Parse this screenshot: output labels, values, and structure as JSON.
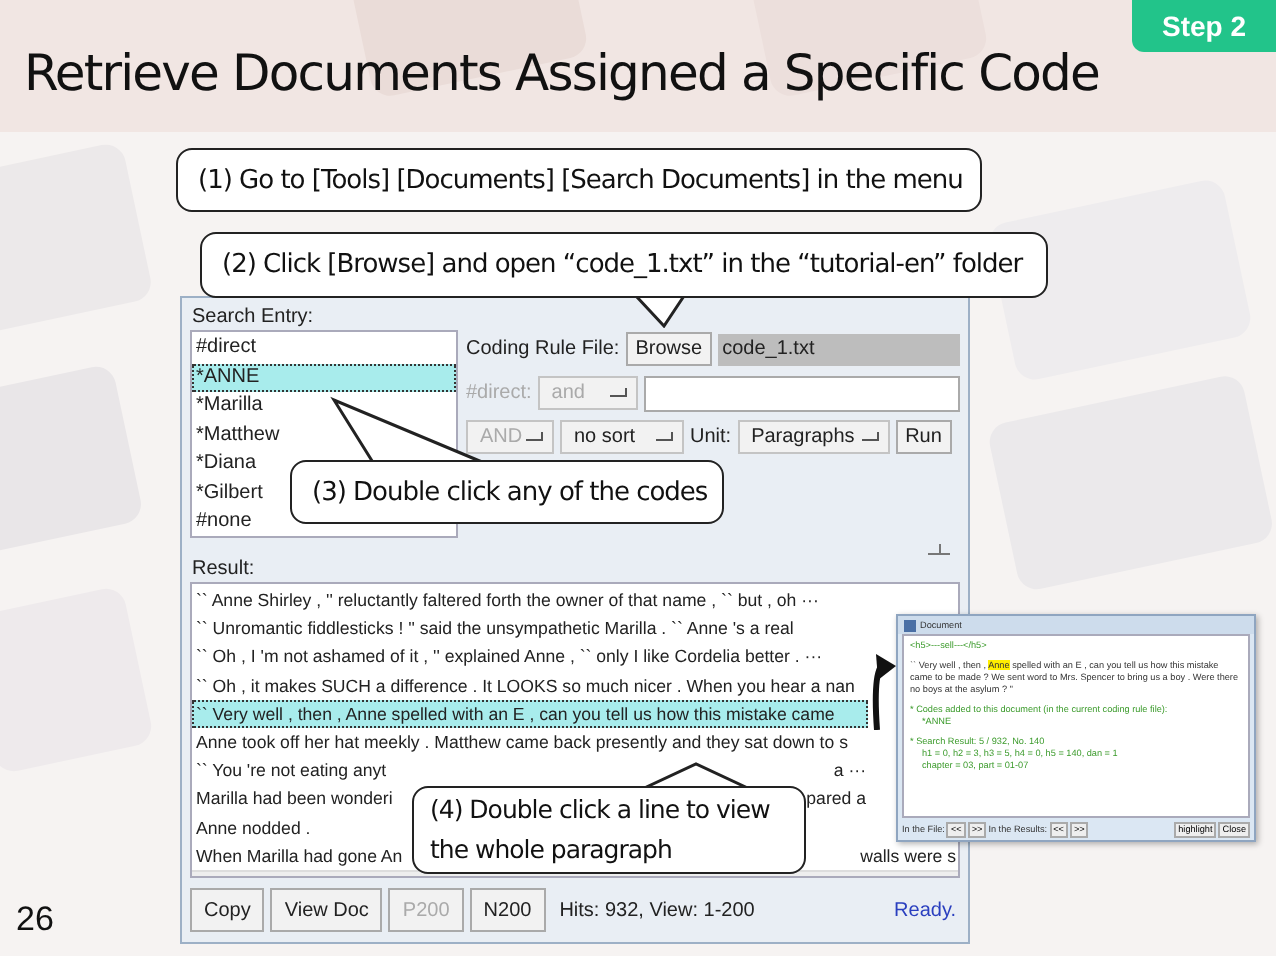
{
  "slide": {
    "title": "Retrieve Documents Assigned a Specific Code",
    "step": "Step 2",
    "page_number": "26"
  },
  "callouts": [
    {
      "kind": "top",
      "text": "(1) Go to [Tools] [Documents] [Search Documents] in the menu"
    },
    {
      "kind": "browse",
      "text": "(2) Click [Browse] and open “code_1.txt” in the “tutorial-en” folder"
    },
    {
      "kind": "codes",
      "text": "(3) Double click any of the codes"
    },
    {
      "kind": "line",
      "text": "(4) Double click a line to view the whole paragraph"
    }
  ],
  "search_window": {
    "search_entry_label": "Search Entry:",
    "codes": [
      {
        "label": "#direct",
        "selected": false
      },
      {
        "label": "*ANNE",
        "selected": true
      },
      {
        "label": "*Marilla",
        "selected": false
      },
      {
        "label": "*Matthew",
        "selected": false
      },
      {
        "label": "*Diana",
        "selected": false
      },
      {
        "label": "*Gilbert",
        "selected": false
      },
      {
        "label": "#none",
        "selected": false
      }
    ],
    "coding_rule_label": "Coding Rule File:",
    "browse_button": "Browse",
    "coding_rule_file": "code_1.txt",
    "direct_label": {
      "text": "#direct:",
      "disabled": true
    },
    "direct_operator": {
      "value": "and",
      "disabled": true
    },
    "operator": {
      "value": "AND",
      "disabled": true
    },
    "sort": {
      "value": "no sort",
      "disabled": false
    },
    "unit_label": "Unit:",
    "unit": {
      "value": "Paragraphs",
      "disabled": false
    },
    "run_button": "Run",
    "result_label": "Result:",
    "results": [
      {
        "text": "`` Anne Shirley , '' reluctantly faltered forth the owner of that name , `` but , oh ···",
        "selected": false
      },
      {
        "text": "`` Unromantic fiddlesticks ! '' said the unsympathetic Marilla . `` Anne 's a real",
        "selected": false
      },
      {
        "text": "`` Oh , I 'm not ashamed of it , '' explained Anne , `` only I like Cordelia better . ···",
        "selected": false
      },
      {
        "text": "`` Oh , it makes SUCH a difference . It LOOKS so much nicer . When you hear a nan",
        "selected": false
      },
      {
        "text": "`` Very well , then , Anne spelled with an E , can you tell us how this mistake came",
        "selected": true
      },
      {
        "text": "Anne took off her hat meekly . Matthew came back presently and they sat down to s",
        "selected": false
      },
      {
        "text": "`` You 're not eating anyt",
        "tail": "a ···",
        "selected": false
      },
      {
        "text": "Marilla had been wonderi",
        "tail": "pared a",
        "selected": false
      },
      {
        "text": "Anne nodded .",
        "selected": false
      },
      {
        "text": "When Marilla had gone An",
        "tail": "walls were s",
        "selected": false
      }
    ],
    "buttons": [
      {
        "label": "Copy",
        "disabled": false
      },
      {
        "label": "View Doc",
        "disabled": false
      },
      {
        "label": "P200",
        "disabled": true
      },
      {
        "label": "N200",
        "disabled": false
      }
    ],
    "hits": "Hits: 932, View: 1-200",
    "status": "Ready."
  },
  "document_window": {
    "title": "Document",
    "heading": "<h5>---sell---</h5>",
    "paragraph": [
      {
        "text": "`` Very well , then , ",
        "highlighted": false
      },
      {
        "text": "Anne",
        "highlighted": true
      },
      {
        "text": " spelled with an E , can you tell us how this mistake came to be made ? We sent word to Mrs. Spencer to bring us a boy . Were there no boys at the asylum ? ''",
        "highlighted": false
      }
    ],
    "info_lines": [
      "* Codes added to this document (in the current coding rule file):",
      "*ANNE",
      "* Search Result: 5 / 932,  No. 140",
      "h1 = 0,  h2 = 3,  h3 = 5,  h4 = 0,  h5 = 140,  dan = 1",
      "chapter = 03,  part = 01-07"
    ],
    "in_file_label": "In the File:",
    "in_results_label": "In the Results:",
    "prev": "<<",
    "next": ">>",
    "highlight_button": "highlight",
    "close_button": "Close"
  }
}
